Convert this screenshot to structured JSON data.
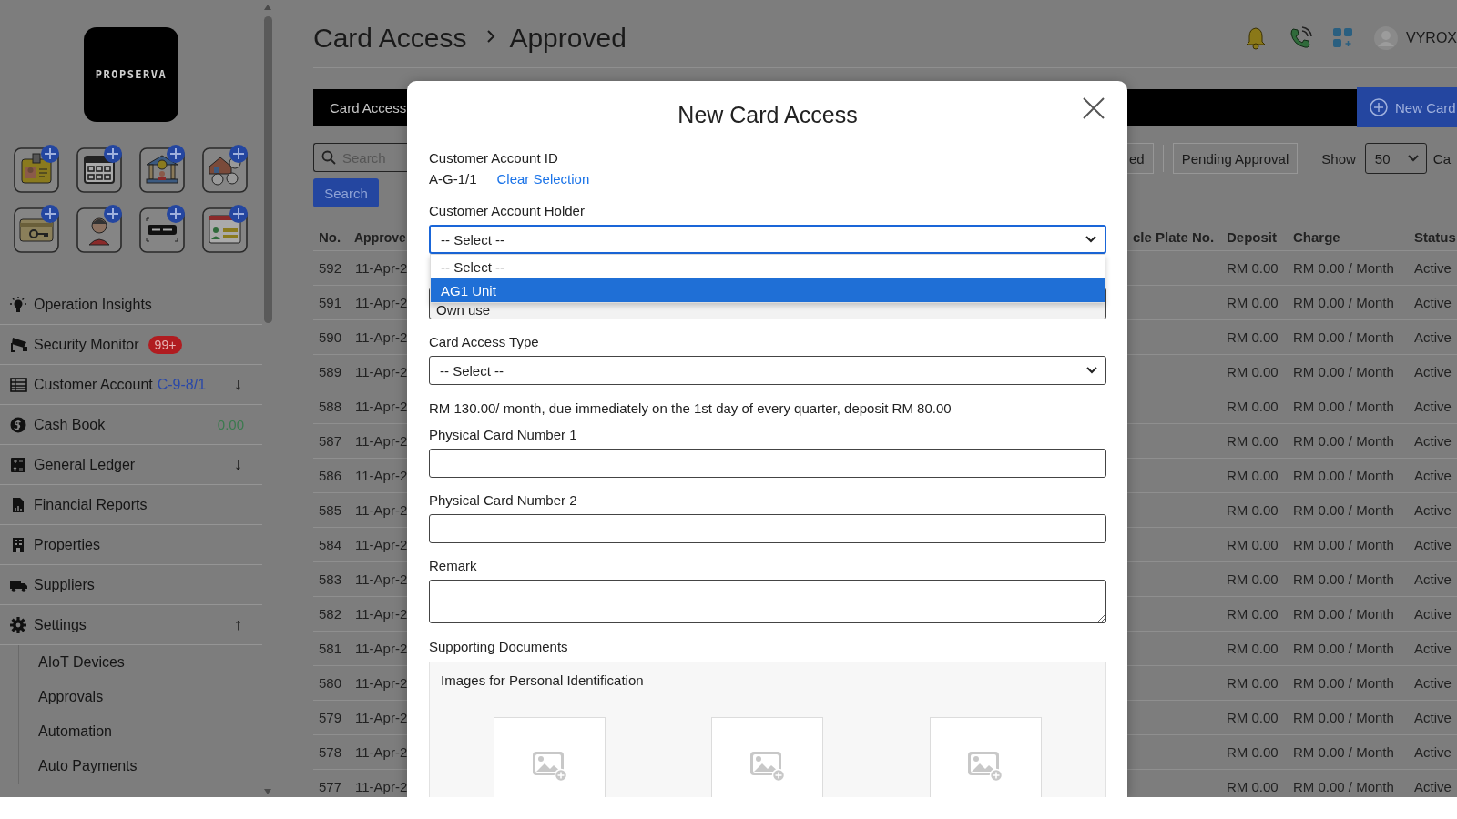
{
  "sidebar": {
    "logo": "PROPSERVA",
    "nav": [
      {
        "label": "Operation Insights"
      },
      {
        "label": "Security Monitor",
        "badge": "99+"
      },
      {
        "label": "Customer Account",
        "code": "C-9-8/1",
        "arrow": "↓"
      },
      {
        "label": "Cash Book",
        "amount": "0.00"
      },
      {
        "label": "General Ledger",
        "arrow": "↓"
      },
      {
        "label": "Financial Reports"
      },
      {
        "label": "Properties"
      },
      {
        "label": "Suppliers"
      },
      {
        "label": "Settings",
        "arrow": "↑",
        "expanded": true,
        "children": [
          {
            "label": "AIoT Devices"
          },
          {
            "label": "Approvals"
          },
          {
            "label": "Automation"
          },
          {
            "label": "Auto Payments"
          }
        ]
      }
    ]
  },
  "header": {
    "title": "Card Access",
    "subtitle": "Approved",
    "user": "VYROX"
  },
  "toolbar": {
    "tab": "Card Access",
    "new_button": "New Card",
    "search_placeholder": "Search",
    "search_button": "Search",
    "filters": [
      {
        "label": "ed"
      },
      {
        "label": "Pending Approval"
      }
    ],
    "show_label": "Show",
    "page_size": "50",
    "cut_label": "Ca"
  },
  "table": {
    "columns": [
      "No.",
      "Approve",
      "cle Plate No.",
      "Deposit",
      "Charge",
      "Status"
    ],
    "rows": [
      {
        "no": "592",
        "column_2": "11-Apr-2",
        "deposit": "RM 0.00",
        "charge": "RM 0.00 / Month",
        "status": "Active"
      },
      {
        "no": "591",
        "column_2": "11-Apr-2",
        "deposit": "RM 0.00",
        "charge": "RM 0.00 / Month",
        "status": "Active"
      },
      {
        "no": "590",
        "column_2": "11-Apr-2",
        "deposit": "RM 0.00",
        "charge": "RM 0.00 / Month",
        "status": "Active"
      },
      {
        "no": "589",
        "column_2": "11-Apr-2",
        "deposit": "RM 0.00",
        "charge": "RM 0.00 / Month",
        "status": "Active"
      },
      {
        "no": "588",
        "column_2": "11-Apr-2",
        "deposit": "RM 0.00",
        "charge": "RM 0.00 / Month",
        "status": "Active"
      },
      {
        "no": "587",
        "column_2": "11-Apr-2",
        "deposit": "RM 0.00",
        "charge": "RM 0.00 / Month",
        "status": "Active"
      },
      {
        "no": "586",
        "column_2": "11-Apr-2",
        "deposit": "RM 0.00",
        "charge": "RM 0.00 / Month",
        "status": "Active"
      },
      {
        "no": "585",
        "column_2": "11-Apr-2",
        "deposit": "RM 0.00",
        "charge": "RM 0.00 / Month",
        "status": "Active"
      },
      {
        "no": "584",
        "column_2": "11-Apr-2",
        "deposit": "RM 0.00",
        "charge": "RM 0.00 / Month",
        "status": "Active"
      },
      {
        "no": "583",
        "column_2": "11-Apr-2",
        "deposit": "RM 0.00",
        "charge": "RM 0.00 / Month",
        "status": "Active"
      },
      {
        "no": "582",
        "column_2": "11-Apr-2",
        "deposit": "RM 0.00",
        "charge": "RM 0.00 / Month",
        "status": "Active"
      },
      {
        "no": "581",
        "column_2": "11-Apr-2",
        "deposit": "RM 0.00",
        "charge": "RM 0.00 / Month",
        "status": "Active"
      },
      {
        "no": "580",
        "column_2": "11-Apr-2",
        "deposit": "RM 0.00",
        "charge": "RM 0.00 / Month",
        "status": "Active"
      },
      {
        "no": "579",
        "column_2": "11-Apr-2",
        "deposit": "RM 0.00",
        "charge": "RM 0.00 / Month",
        "status": "Active"
      },
      {
        "no": "578",
        "column_2": "11-Apr-2",
        "deposit": "RM 0.00",
        "charge": "RM 0.00 / Month",
        "status": "Active"
      },
      {
        "no": "577",
        "column_2": "11-Apr-2",
        "deposit": "RM 0.00",
        "charge": "RM 0.00 / Month",
        "status": "Active"
      }
    ]
  },
  "modal": {
    "title": "New Card Access",
    "account_id_label": "Customer Account ID",
    "account_id": "A-G-1/1",
    "clear_link": "Clear Selection",
    "holder_label": "Customer Account Holder",
    "holder_value": "-- Select --",
    "holder_options": [
      {
        "label": "-- Select --",
        "selected": false
      },
      {
        "label": "AG1 Unit",
        "selected": true
      }
    ],
    "usage_value": "Own use",
    "type_label": "Card Access Type",
    "type_value": "-- Select --",
    "info": "RM 130.00/ month, due immediately on the 1st day of every quarter, deposit RM 80.00",
    "card1_label": "Physical Card Number 1",
    "card2_label": "Physical Card Number 2",
    "remark_label": "Remark",
    "docs_label": "Supporting Documents",
    "images_label": "Images for Personal Identification",
    "image_slots": [
      {
        "kind": "upload"
      },
      {
        "kind": "upload"
      },
      {
        "kind": "upload"
      }
    ]
  }
}
